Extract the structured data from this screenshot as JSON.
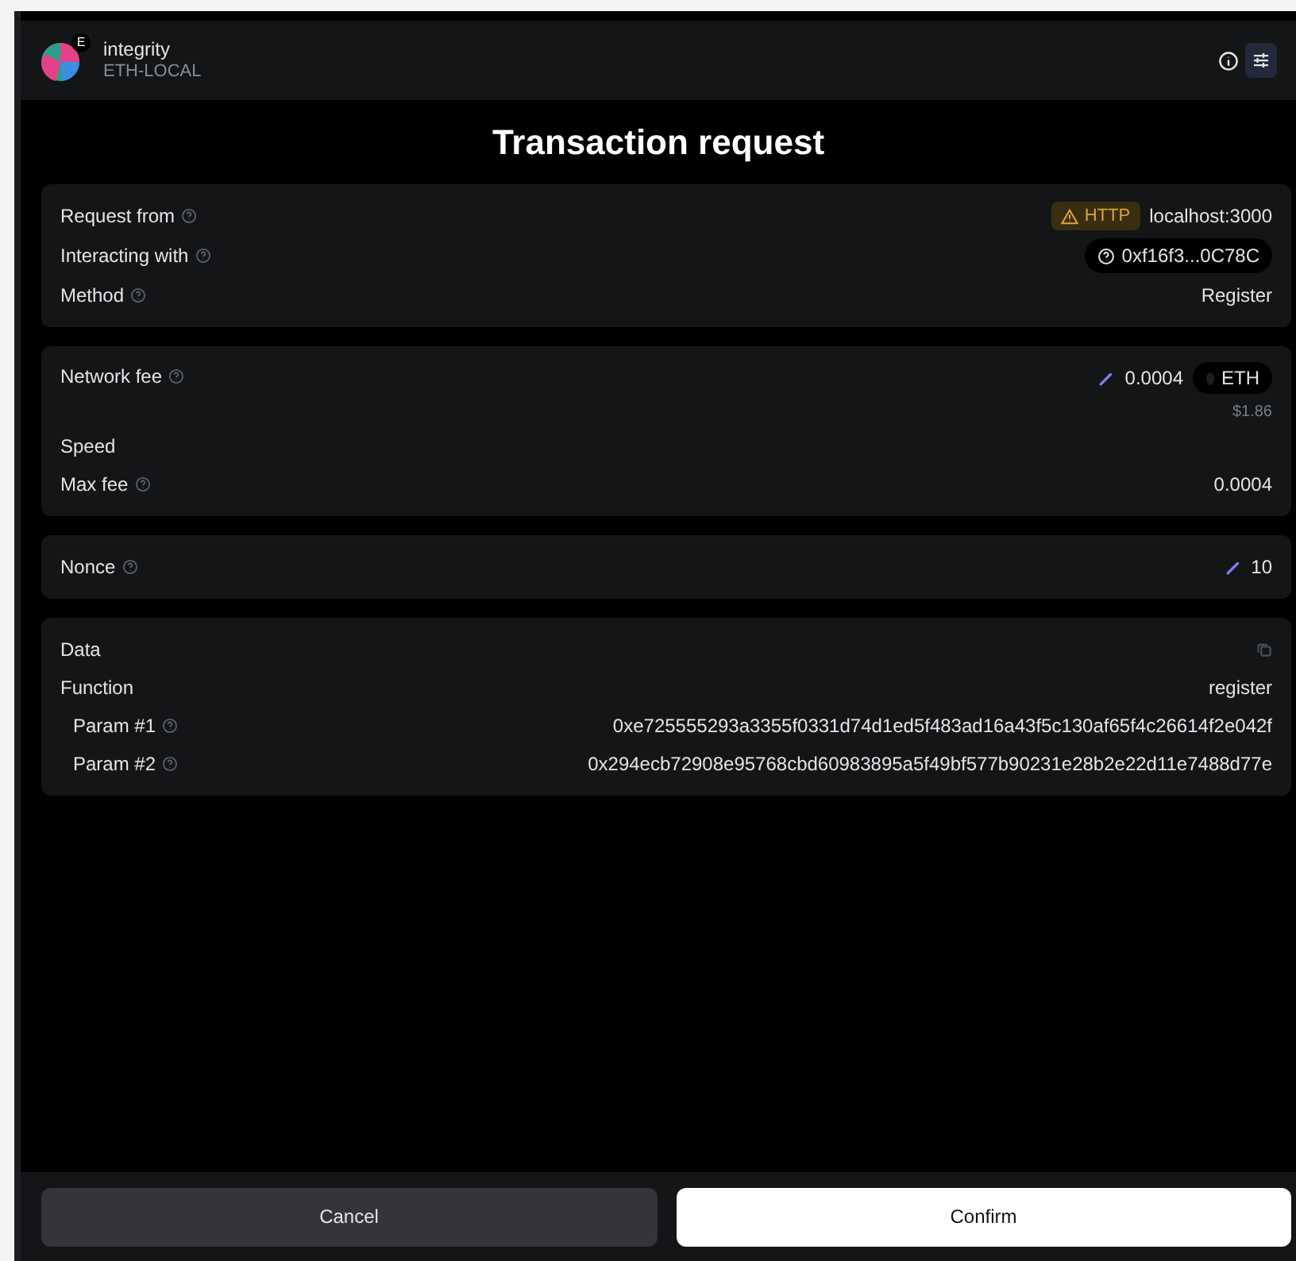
{
  "header": {
    "badge": "E",
    "title": "integrity",
    "network": "ETH-LOCAL"
  },
  "title": "Transaction request",
  "sections": [
    {
      "rows": [
        {
          "kind": "origin",
          "label": "Request from",
          "help": true,
          "badge": "HTTP",
          "value": "localhost:3000"
        },
        {
          "kind": "address",
          "label": "Interacting with",
          "help": true,
          "value": "0xf16f3...0C78C"
        },
        {
          "kind": "text",
          "label": "Method",
          "help": true,
          "value": "Register"
        }
      ]
    },
    {
      "rows": [
        {
          "kind": "fee",
          "label": "Network fee",
          "help": true,
          "value": "0.0004",
          "token": "ETH",
          "fiat": "$1.86"
        },
        {
          "kind": "label",
          "label": "Speed",
          "help": false
        },
        {
          "kind": "text",
          "label": "Max fee",
          "help": true,
          "value": "0.0004"
        }
      ]
    },
    {
      "rows": [
        {
          "kind": "editable",
          "label": "Nonce",
          "help": true,
          "value": "10"
        }
      ]
    },
    {
      "rows": [
        {
          "kind": "copy",
          "label": "Data",
          "help": false
        },
        {
          "kind": "text",
          "label": "Function",
          "help": false,
          "value": "register"
        },
        {
          "kind": "param",
          "label": "Param #1",
          "help": true,
          "value": "0xe725555293a3355f0331d74d1ed5f483ad16a43f5c130af65f4c26614f2e042f"
        },
        {
          "kind": "param",
          "label": "Param #2",
          "help": true,
          "value": "0x294ecb72908e95768cbd60983895a5f49bf577b90231e28b2e22d11e7488d77e"
        }
      ]
    }
  ],
  "buttons": {
    "cancel": "Cancel",
    "confirm": "Confirm"
  }
}
